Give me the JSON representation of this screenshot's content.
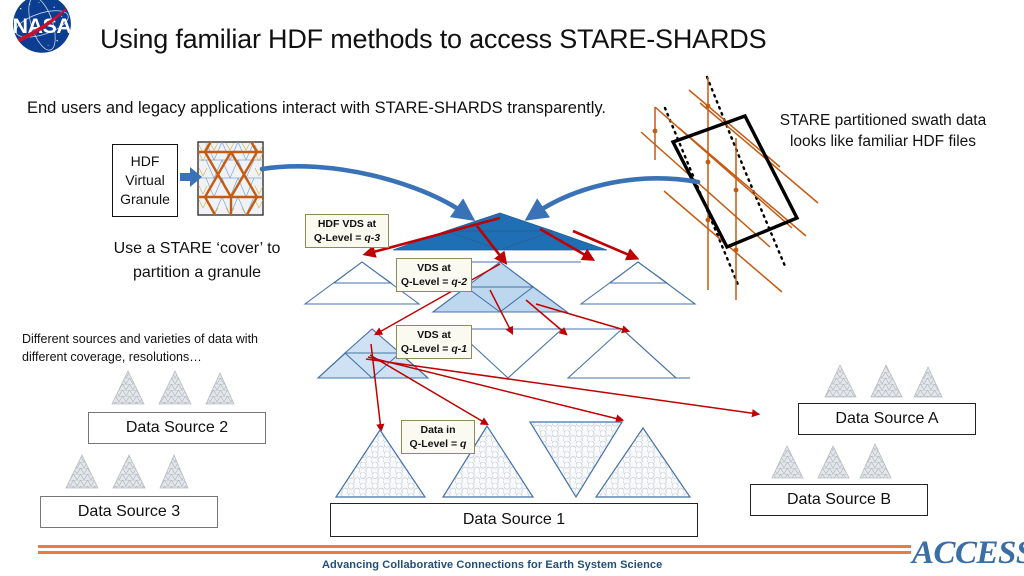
{
  "slide": {
    "title": "Using familiar HDF methods to access STARE-SHARDS",
    "lead_text": "End users and legacy applications interact with STARE-SHARDS transparently.",
    "swath_caption_line1": "STARE partitioned swath data",
    "swath_caption_line2": "looks like familiar HDF files",
    "cover_caption_line1": "Use a STARE ‘cover’ to",
    "cover_caption_line2": "partition a granule",
    "varieties_caption_line1": "Different sources and varieties of data with",
    "varieties_caption_line2": "different coverage, resolutions…"
  },
  "hdf_virtual_granule": {
    "line1": "HDF",
    "line2": "Virtual",
    "line3": "Granule"
  },
  "qlevels": [
    {
      "name": "hdf-vds-q3",
      "line1": "HDF VDS at",
      "prefix": "Q-Level = ",
      "value": "q-3"
    },
    {
      "name": "vds-q2",
      "line1": "VDS at",
      "prefix": "Q-Level = ",
      "value": "q-2"
    },
    {
      "name": "vds-q1",
      "line1": "VDS at",
      "prefix": "Q-Level = ",
      "value": "q-1"
    },
    {
      "name": "data-q",
      "line1": "Data in",
      "prefix": "Q-Level = ",
      "value": "q"
    }
  ],
  "data_sources": {
    "source_1": "Data Source 1",
    "source_2": "Data Source 2",
    "source_3": "Data Source 3",
    "source_a": "Data Source A",
    "source_b": "Data Source B"
  },
  "logo": {
    "nasa_word": "NASA"
  },
  "footer": {
    "tagline": "Advancing Collaborative Connections for Earth System Science",
    "brand": "ACCESS"
  },
  "colors": {
    "accent_orange": "#ec7c3c",
    "footer_blue": "#1f4e79",
    "access_blue": "#3a6ea5",
    "arrow_blue": "#3a72b8",
    "arrow_red": "#c00000",
    "triangle_stroke": "#4472a8",
    "triangle_fill_dark": "#1f6fb4",
    "triangle_fill_mid": "#9dc3e6",
    "triangle_fill_light": "#cfe2f3",
    "callout_border": "#8d8b5a",
    "callout_fill": "#fbfaf1",
    "mesh_orange": "#c55a11",
    "nasa_blue": "#0b3d91",
    "nasa_red": "#c8102e"
  }
}
